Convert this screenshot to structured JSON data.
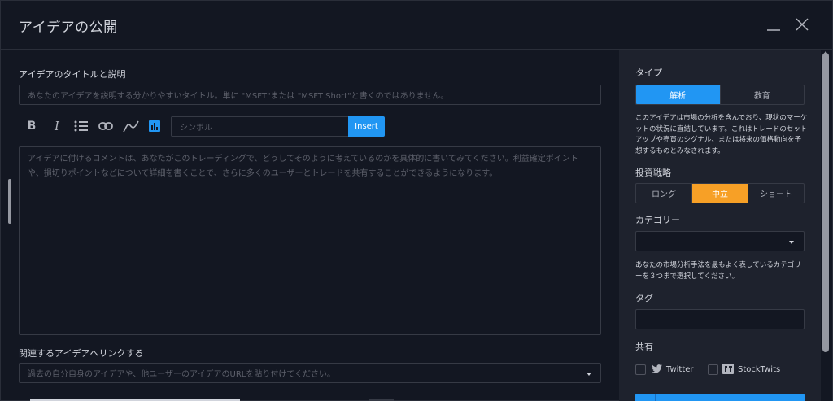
{
  "dialog": {
    "title": "アイデアの公開"
  },
  "left": {
    "title_label": "アイデアのタイトルと説明",
    "title_placeholder": "あなたのアイデアを説明する分かりやすいタイトル。単に \"MSFT\"または \"MSFT Short\"と書くのではありません。",
    "toolbar": {
      "bold": "B",
      "italic": "I",
      "symbol_placeholder": "シンボル",
      "insert_label": "Insert"
    },
    "comment_placeholder": "アイデアに付けるコメントは、あなたがこのトレーディングで、どうしてそのように考えているのかを具体的に書いてみてください。利益確定ポイントや、損切りポイントなどについて詳細を書くことで、さらに多くのユーザーとトレードを共有することができるようになります。",
    "related_label": "関連するアイデアへリンクする",
    "related_placeholder": "過去の自分自身のアイデアや、他ユーザーのアイデアのURLを貼り付けてください。"
  },
  "right": {
    "type_label": "タイプ",
    "type_options": [
      "解析",
      "教育"
    ],
    "type_description": "このアイデアは市場の分析を含んでおり、現状のマーケットの状況に直結しています。これはトレードのセットアップや売買のシグナル、または将来の価格動向を予想するものとみなされます。",
    "strategy_label": "投資戦略",
    "strategy_options": [
      "ロング",
      "中立",
      "ショート"
    ],
    "category_label": "カテゴリー",
    "category_description": "あなたの市場分析手法を最もよく表しているカテゴリーを３つまで選択してください。",
    "tag_label": "タグ",
    "share_label": "共有",
    "share_twitter": "Twitter",
    "share_stocktwits": "StockTwits"
  },
  "colors": {
    "accent_blue": "#2196f3",
    "accent_orange": "#f7a026",
    "background": "#131722",
    "panel": "#1e222d"
  }
}
